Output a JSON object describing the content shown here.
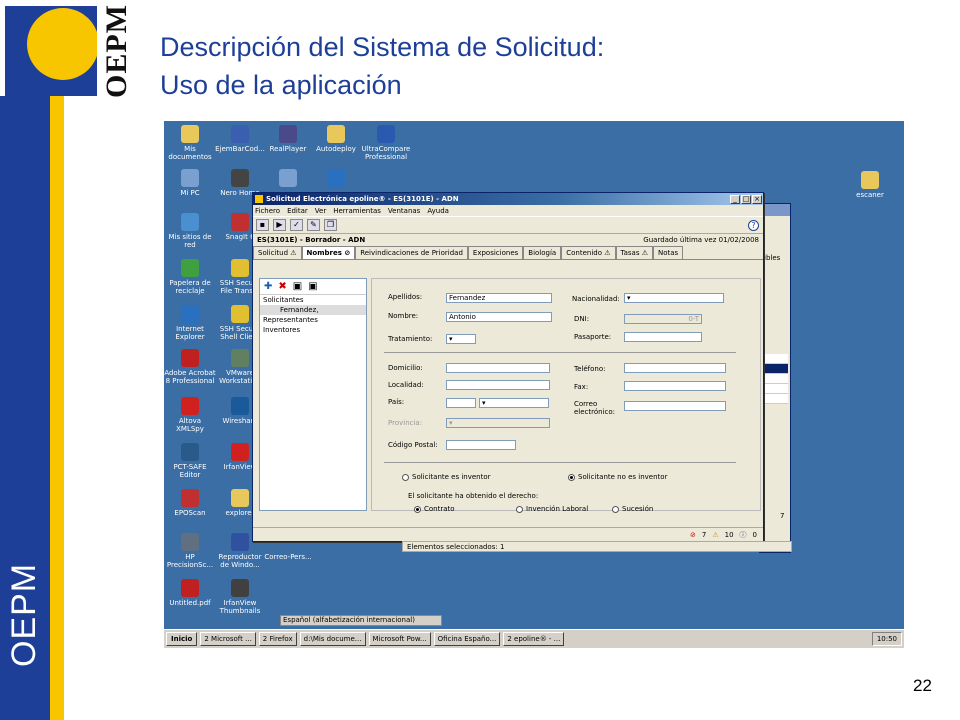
{
  "slide": {
    "logo_text": "OEPM",
    "vertical_brand": "OEPM",
    "title_line1": "Descripción del Sistema de Solicitud:",
    "title_line2": "Uso de la aplicación",
    "page_number": "22"
  },
  "desktop_icons": [
    {
      "label": "Mis documentos",
      "icon": "folder-icon",
      "color": "#e8c85a"
    },
    {
      "label": "EjemBarCod...",
      "icon": "word-doc-icon",
      "color": "#3a5fb0"
    },
    {
      "label": "RealPlayer",
      "icon": "realplayer-icon",
      "color": "#4a4a8a"
    },
    {
      "label": "Autodeploy",
      "icon": "folder-icon",
      "color": "#e8c85a"
    },
    {
      "label": "UltraCompare Professional",
      "icon": "ultracompare-icon",
      "color": "#2a5ab0"
    },
    {
      "label": "Mi PC",
      "icon": "computer-icon",
      "color": "#7aa0d0"
    },
    {
      "label": "Nero Home",
      "icon": "nero-icon",
      "color": "#444"
    },
    {
      "label": "",
      "icon": "program-icon",
      "color": "#7aa0d0"
    },
    {
      "label": "",
      "icon": "internet-icon",
      "color": "#2a70c0"
    },
    {
      "label": "Mis sitios de red",
      "icon": "network-icon",
      "color": "#4a90d0"
    },
    {
      "label": "SnagIt 6",
      "icon": "snagit-icon",
      "color": "#c03030"
    },
    {
      "label": "Papelera de reciclaje",
      "icon": "recycle-bin-icon",
      "color": "#40a040"
    },
    {
      "label": "SSH Secure File Trans...",
      "icon": "ssh-file-icon",
      "color": "#e0c030"
    },
    {
      "label": "Internet Explorer",
      "icon": "ie-icon",
      "color": "#2a70c0"
    },
    {
      "label": "SSH Secure Shell Client",
      "icon": "ssh-shell-icon",
      "color": "#e0c030"
    },
    {
      "label": "Adobe Acrobat 8 Professional",
      "icon": "acrobat-icon",
      "color": "#c02020"
    },
    {
      "label": "VMware Workstation",
      "icon": "vmware-icon",
      "color": "#608060"
    },
    {
      "label": "Altova XMLSpy",
      "icon": "xmlspy-icon",
      "color": "#d02020"
    },
    {
      "label": "Wireshark",
      "icon": "wireshark-icon",
      "color": "#1a5a9a"
    },
    {
      "label": "PCT-SAFE Editor",
      "icon": "pct-safe-icon",
      "color": "#2a5a8a"
    },
    {
      "label": "IrfanView",
      "icon": "irfanview-icon",
      "color": "#d02020"
    },
    {
      "label": "EPOScan",
      "icon": "eposcan-icon",
      "color": "#c03030"
    },
    {
      "label": "explorer",
      "icon": "explorer-icon",
      "color": "#e8c85a"
    },
    {
      "label": "HP PrecisionSc...",
      "icon": "scanner-icon",
      "color": "#607080"
    },
    {
      "label": "Reproductor de Windo...",
      "icon": "media-player-icon",
      "color": "#3050a0"
    },
    {
      "label": "Correo-Pers...",
      "icon": "mail-icon",
      "color": "#3a6ea5"
    },
    {
      "label": "Untitled.pdf",
      "icon": "pdf-icon",
      "color": "#c02020"
    },
    {
      "label": "IrfanView Thumbnails",
      "icon": "irfanview-thumbs-icon",
      "color": "#404040"
    },
    {
      "label": "escaner",
      "icon": "folder-icon",
      "color": "#e8c85a"
    }
  ],
  "back_window": {
    "text": "ibles",
    "count": "7"
  },
  "app": {
    "title": "Solicitud Electrónica epoline® - ES(3101E) - ADN",
    "menu": [
      "Fichero",
      "Editar",
      "Ver",
      "Herramientas",
      "Ventanas",
      "Ayuda"
    ],
    "toolbar_icons": [
      "save-icon",
      "play-icon",
      "check-icon",
      "sign-icon",
      "pages-icon"
    ],
    "document_name": "ES(3101E) - Borrador - ADN",
    "saved_info": "Guardado última vez  01/02/2008",
    "tabs": [
      "Solicitud",
      "Nombres",
      "Reivindicaciones de Prioridad",
      "Exposiciones",
      "Biología",
      "Contenido",
      "Tasas",
      "Notas"
    ],
    "tree": {
      "items": [
        "Solicitantes",
        "Fernandez,",
        "Representantes",
        "Inventores"
      ]
    },
    "form": {
      "apellidos_label": "Apellidos:",
      "apellidos_value": "Fernandez",
      "nombre_label": "Nombre:",
      "nombre_value": "Antonio",
      "tratamiento_label": "Tratamiento:",
      "nacionalidad_label": "Nacionalidad:",
      "dni_label": "DNI:",
      "dni_value": "0-T",
      "pasaporte_label": "Pasaporte:",
      "domicilio_label": "Domicilio:",
      "localidad_label": "Localidad:",
      "pais_label": "País:",
      "provincia_label": "Provincia:",
      "codigo_postal_label": "Código Postal:",
      "telefono_label": "Teléfono:",
      "fax_label": "Fax:",
      "correo_label": "Correo electrónico:",
      "radio_inventor": "Solicitante es inventor",
      "radio_no_inventor": "Solicitante no es inventor",
      "derecho_label": "El solicitante ha obtenido el derecho:",
      "radio_contrato": "Contrato",
      "radio_invencion": "Invención Laboral",
      "radio_sucesion": "Sucesión"
    },
    "status": {
      "errors": "7",
      "warnings": "10",
      "info": "0"
    },
    "selection_text": "Elementos seleccionados: 1"
  },
  "language_bar": "Español (alfabetización internacional)",
  "taskbar": {
    "start": "Inicio",
    "buttons": [
      "2 Microsoft ...",
      "2 Firefox",
      "d:\\Mis docume...",
      "Microsoft Pow...",
      "Oficina Españo...",
      "2 epoline® - ..."
    ],
    "clock": "10:50"
  }
}
